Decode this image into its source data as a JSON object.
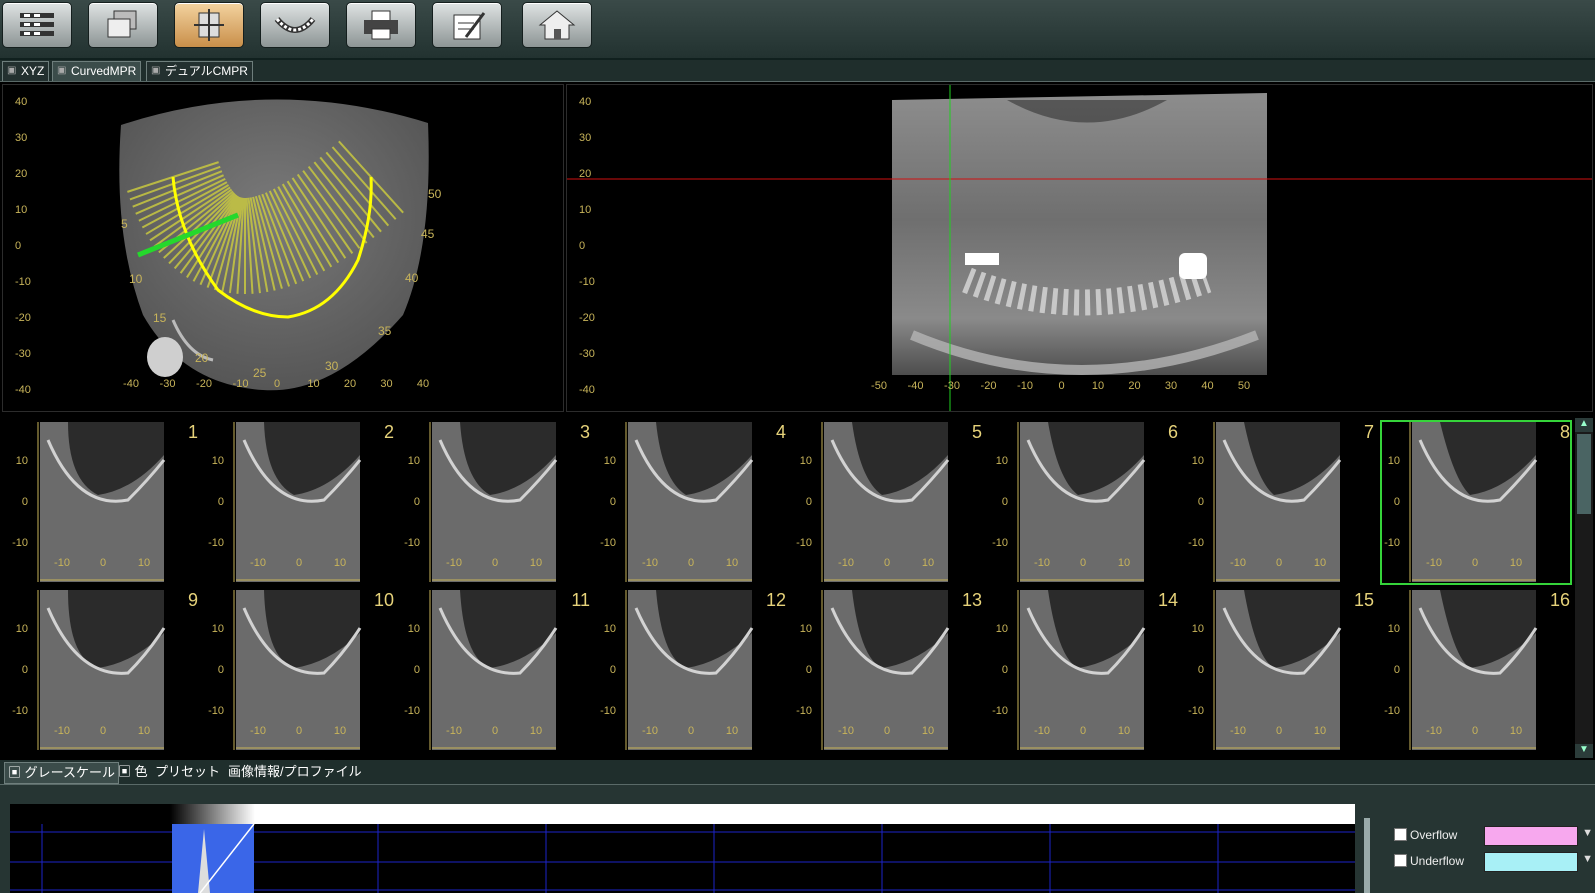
{
  "toolbar": {
    "buttons": [
      {
        "name": "list-view",
        "icon": "list-icon"
      },
      {
        "name": "layers",
        "icon": "stack-icon"
      },
      {
        "name": "mpr",
        "icon": "cube-axes-icon",
        "active": true
      },
      {
        "name": "panorama",
        "icon": "dental-arch-icon"
      },
      {
        "name": "print",
        "icon": "printer-icon"
      },
      {
        "name": "report",
        "icon": "edit-note-icon"
      },
      {
        "name": "home",
        "icon": "home-icon"
      }
    ]
  },
  "tabs": [
    {
      "label": "XYZ"
    },
    {
      "label": "CurvedMPR",
      "active": true
    },
    {
      "label": "デュアルCMPR"
    }
  ],
  "axial": {
    "y_ticks": [
      "40",
      "30",
      "20",
      "10",
      "0",
      "-10",
      "-20",
      "-30",
      "-40"
    ],
    "x_ticks": [
      "-40",
      "-30",
      "-20",
      "-10",
      "0",
      "10",
      "20",
      "30",
      "40"
    ],
    "slice_labels": [
      "5",
      "10",
      "15",
      "20",
      "25",
      "30",
      "35",
      "40",
      "45",
      "50"
    ]
  },
  "panoramic": {
    "y_ticks": [
      "40",
      "30",
      "20",
      "10",
      "0",
      "-10",
      "-20",
      "-30",
      "-40"
    ],
    "x_ticks": [
      "-50",
      "-40",
      "-30",
      "-20",
      "-10",
      "0",
      "10",
      "20",
      "30",
      "40",
      "50"
    ]
  },
  "cross_sections": {
    "y_ticks": [
      "10",
      "0",
      "-10"
    ],
    "x_ticks": [
      "-10",
      "0",
      "10"
    ],
    "items": [
      "1",
      "2",
      "3",
      "4",
      "5",
      "6",
      "7",
      "8",
      "9",
      "10",
      "11",
      "12",
      "13",
      "14",
      "15",
      "16"
    ],
    "selected": "8"
  },
  "bottom_tabs": [
    "グレースケール",
    "色",
    "プリセット",
    "画像情報/プロファイル"
  ],
  "options": {
    "overflow_label": "Overflow",
    "underflow_label": "Underflow",
    "overflow_color": "#f7a8ee",
    "underflow_color": "#a8f0f6"
  },
  "colors": {
    "toolbar": "#2d3d3b",
    "accent_active": "#d9a05a",
    "curve": "#ffff00",
    "slice_lines": "#c8c840",
    "selection": "#35d43a",
    "crosshair_h": "#d01010",
    "crosshair_v": "#20d020",
    "histogram_window": "#3a66e8"
  }
}
